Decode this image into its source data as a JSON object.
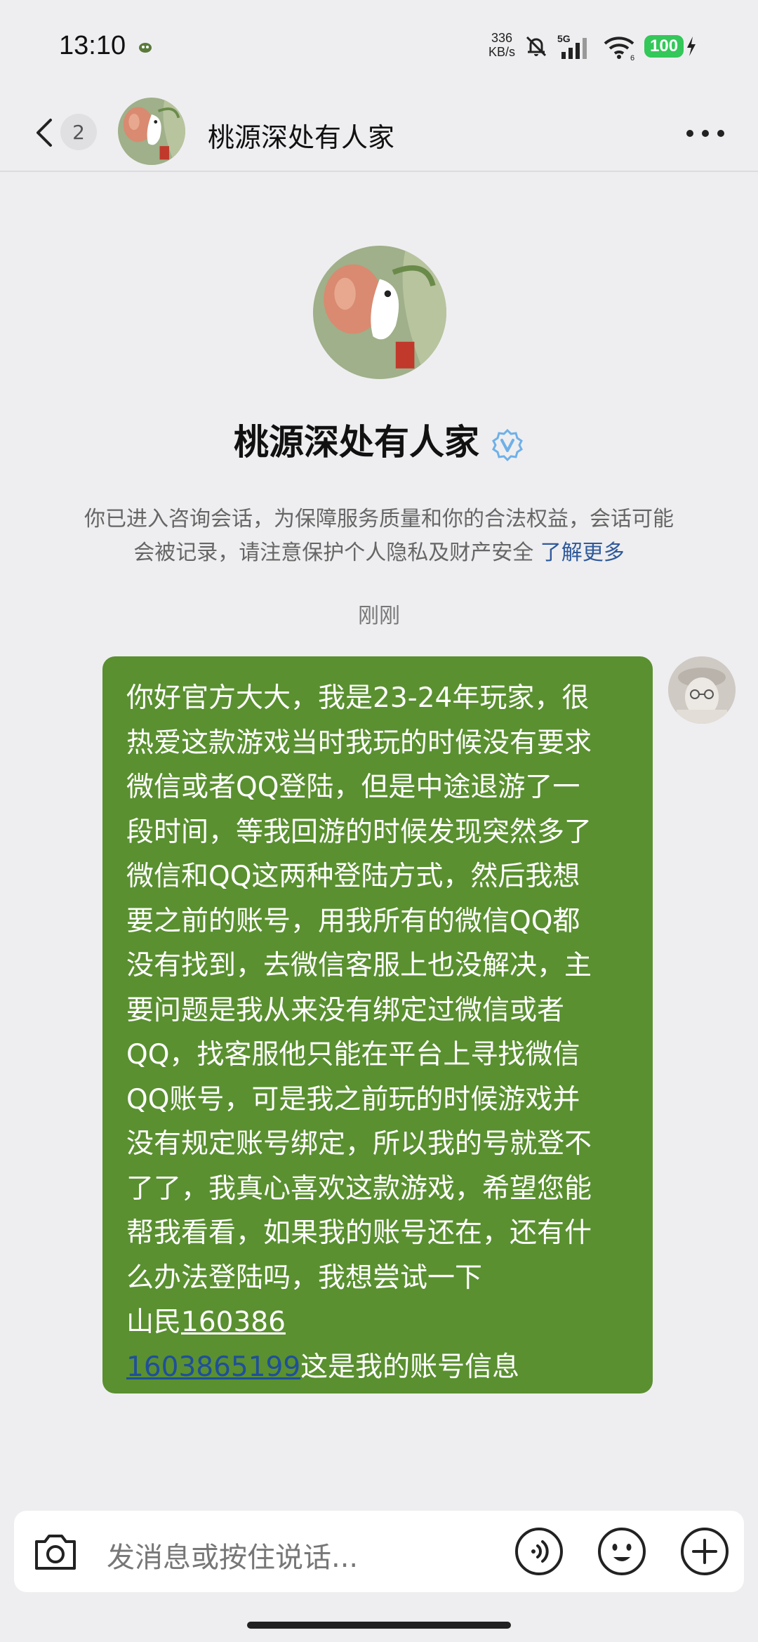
{
  "status_bar": {
    "time": "13:10",
    "net_speed_value": "336",
    "net_speed_unit": "KB/s",
    "network": "5G",
    "wifi_level": "6",
    "battery": "100"
  },
  "header": {
    "unread_count": "2",
    "title": "桃源深处有人家"
  },
  "profile": {
    "name": "桃源深处有人家"
  },
  "notice": {
    "text": "你已进入咨询会话，为保障服务质量和你的合法权益，会话可能会被记录，请注意保护个人隐私及财产安全",
    "link": "了解更多"
  },
  "timestamp": "刚刚",
  "message": {
    "lines": [
      "你好官方大大，我是23-24年玩家，很",
      "热爱这款游戏当时我玩的时候没有要求",
      "微信或者QQ登陆，但是中途退游了一",
      "段时间，等我回游的时候发现突然多了",
      "微信和QQ这两种登陆方式，然后我想",
      "要之前的账号，用我所有的微信QQ都",
      "没有找到，去微信客服上也没解决，主",
      "要问题是我从来没有绑定过微信或者",
      "QQ，找客服他只能在平台上寻找微信",
      "QQ账号，可是我之前玩的时候游戏并",
      "没有规定账号绑定，所以我的号就登不",
      "了了，我真心喜欢这款游戏，希望您能",
      "帮我看看，如果我的账号还在，还有什",
      "么办法登陆吗，我想尝试一下"
    ],
    "line15_prefix": "山民",
    "line15_number": "160386",
    "line16_number": "1603865199",
    "line16_suffix": "这是我的账号信息"
  },
  "input": {
    "placeholder": "发消息或按住说话..."
  },
  "icons": {
    "back": "back-chevron-icon",
    "more": "more-dots-icon",
    "verified": "verified-badge-icon",
    "camera": "camera-icon",
    "voice": "voice-icon",
    "emoji": "emoji-icon",
    "plus": "plus-icon"
  },
  "colors": {
    "bubble": "#5a9030",
    "link": "#2f5a9a",
    "battery": "#34c759",
    "verified": "#6fb0e8"
  }
}
